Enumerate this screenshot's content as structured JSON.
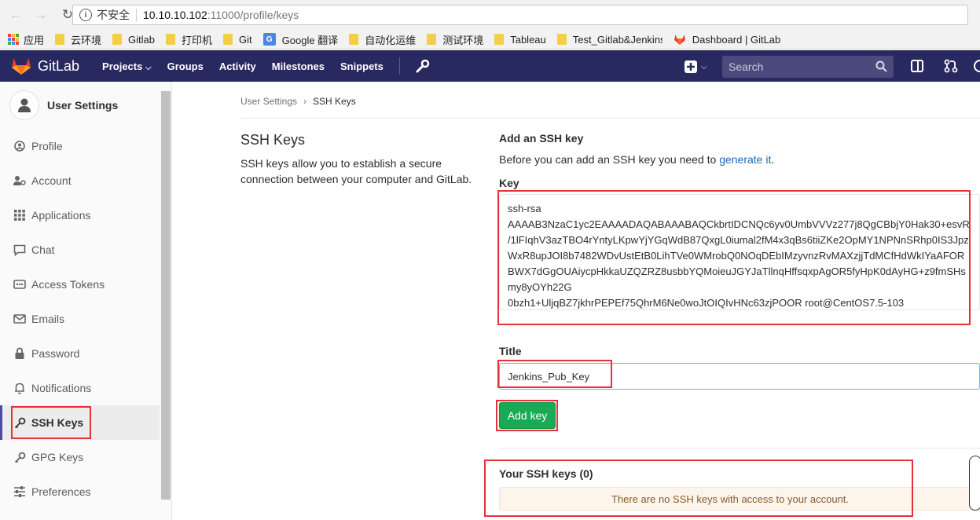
{
  "browser": {
    "back_icon": "arrow-left-icon",
    "forward_icon": "arrow-right-icon",
    "reload_icon": "reload-icon",
    "insecure_label": "不安全",
    "url_host": "10.10.10.102",
    "url_path": ":11000/profile/keys"
  },
  "bookmarks": [
    {
      "label": "应用",
      "icon": "apps-grid-icon"
    },
    {
      "label": "云环境",
      "icon": "folder-icon"
    },
    {
      "label": "Gitlab",
      "icon": "folder-icon"
    },
    {
      "label": "打印机",
      "icon": "folder-icon"
    },
    {
      "label": "Git",
      "icon": "folder-icon"
    },
    {
      "label": "Google 翻译",
      "icon": "google-translate-icon"
    },
    {
      "label": "自动化运维",
      "icon": "folder-icon"
    },
    {
      "label": "测试环境",
      "icon": "folder-icon"
    },
    {
      "label": "Tableau",
      "icon": "folder-icon"
    },
    {
      "label": "Test_Gitlab&Jenkins",
      "icon": "folder-icon"
    },
    {
      "label": "Dashboard | GitLab",
      "icon": "gitlab-fox-icon"
    }
  ],
  "navbar": {
    "brand": "GitLab",
    "links": [
      "Projects",
      "Groups",
      "Activity",
      "Milestones",
      "Snippets"
    ],
    "search_placeholder": "Search"
  },
  "sidebar": {
    "title": "User Settings",
    "items": [
      {
        "label": "Profile",
        "icon": "profile-icon",
        "active": false
      },
      {
        "label": "Account",
        "icon": "account-icon",
        "active": false
      },
      {
        "label": "Applications",
        "icon": "applications-icon",
        "active": false
      },
      {
        "label": "Chat",
        "icon": "chat-icon",
        "active": false
      },
      {
        "label": "Access Tokens",
        "icon": "access-tokens-icon",
        "active": false
      },
      {
        "label": "Emails",
        "icon": "emails-icon",
        "active": false
      },
      {
        "label": "Password",
        "icon": "lock-icon",
        "active": false
      },
      {
        "label": "Notifications",
        "icon": "bell-icon",
        "active": false
      },
      {
        "label": "SSH Keys",
        "icon": "key-icon",
        "active": true
      },
      {
        "label": "GPG Keys",
        "icon": "key-icon",
        "active": false
      },
      {
        "label": "Preferences",
        "icon": "preferences-icon",
        "active": false
      }
    ]
  },
  "breadcrumb": {
    "parent": "User Settings",
    "current": "SSH Keys"
  },
  "left_col": {
    "title": "SSH Keys",
    "desc": "SSH keys allow you to establish a secure connection between your computer and GitLab."
  },
  "form": {
    "heading": "Add an SSH key",
    "desc_prefix": "Before you can add an SSH key you need to ",
    "desc_link": "generate it",
    "desc_suffix": ".",
    "key_label": "Key",
    "key_lines": [
      "ssh-rsa",
      "AAAAB3NzaC1yc2EAAAADAQABAAABAQCkbrtIDCNQc6yv0UmbVVVz277j8QgCBbjY0Hak30+esvR",
      "/1lFIqhV3azTBO4rYntyLKpwYjYGqWdB87QxgL0iumal2fM4x3qBs6tiiZKe2OpMY1NPNnSRhp0IS3Jpz",
      "WxR8upJOI8b7482WDvUstEtB0LihTVe0WMrobQ0NOqDEbIMzyvnzRvMAXzjjTdMCfHdWkIYaAFOR",
      "BWX7dGgOUAiycpHkkaUZQZRZ8usbbYQMoieuJGYJaTllnqHffsqxpAgOR5fyHpK0dAyHG+z9fmSHs",
      "my8yOYh22G",
      "0bzh1+UljqBZ7jkhrPEPEf75QhrM6Ne0woJtOIQIvHNc63zjPOOR root@CentOS7.5-103"
    ],
    "title_label": "Title",
    "title_value": "Jenkins_Pub_Key",
    "submit_label": "Add key"
  },
  "your_keys": {
    "title": "Your SSH keys (0)",
    "empty_message": "There are no SSH keys with access to your account."
  },
  "colors": {
    "navbar_bg": "#292961",
    "primary_button": "#1aaa55",
    "link": "#1b69b6",
    "annotation_red": "#e5323a"
  }
}
